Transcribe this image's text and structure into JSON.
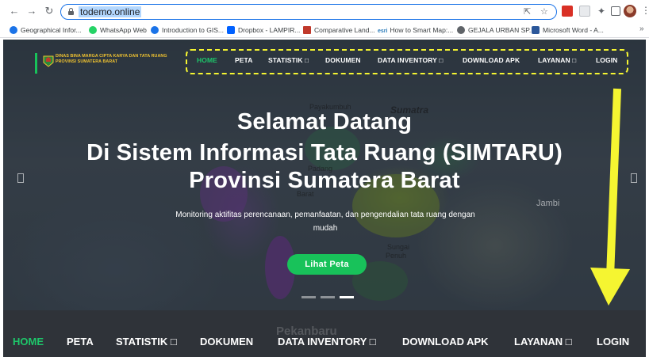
{
  "browser": {
    "url": "todemo.online",
    "bookmarks": [
      "Geographical Infor...",
      "WhatsApp Web",
      "Introduction to GIS...",
      "Dropbox - LAMPIR...",
      "Comparative Land...",
      "How to Smart Map:...",
      "GEJALA URBAN SP...",
      "Microsoft Word - A..."
    ],
    "bookmark_colors": [
      "#1a73e8",
      "#25d366",
      "#1a73e8",
      "#0061ff",
      "#c0392b",
      "#2b7bb9",
      "#5f6368",
      "#2b579a"
    ],
    "bookmark_esri_tag": "esri",
    "more_label": "»"
  },
  "site": {
    "logo_line1": "DINAS BINA MARGA CIPTA KARYA DAN TATA RUANG",
    "logo_line2": "PROVINSI SUMATERA BARAT",
    "nav": [
      "HOME",
      "PETA",
      "STATISTIK □",
      "DOKUMEN",
      "DATA INVENTORY □",
      "DOWNLOAD APK",
      "LAYANAN □",
      "LOGIN"
    ],
    "active_nav": "HOME",
    "accent_color": "#18c25a"
  },
  "hero": {
    "title_line1": "Selamat Datang",
    "title_line2": "Di Sistem Informasi Tata Ruang (SIMTARU)",
    "title_line3": "Provinsi Sumatera Barat",
    "subtitle_line1": "Monitoring aktifitas perencanaan, pemanfaatan, dan pengendalian tata ruang dengan",
    "subtitle_line2": "mudah",
    "cta_label": "Lihat Peta",
    "map_labels": [
      "Sumatra",
      "Payakumbuh",
      "Padang",
      "Barat",
      "Jambi",
      "Sungai",
      "Penuh",
      "Pekanbaru"
    ],
    "slide_count": 3,
    "active_slide": 3
  },
  "bottom_nav": [
    "HOME",
    "PETA",
    "STATISTIK □",
    "DOKUMEN",
    "DATA INVENTORY □",
    "DOWNLOAD APK",
    "LAYANAN □",
    "LOGIN"
  ],
  "annotation": {
    "highlight_color": "#f5f531",
    "arrow_color": "#f5f531"
  }
}
